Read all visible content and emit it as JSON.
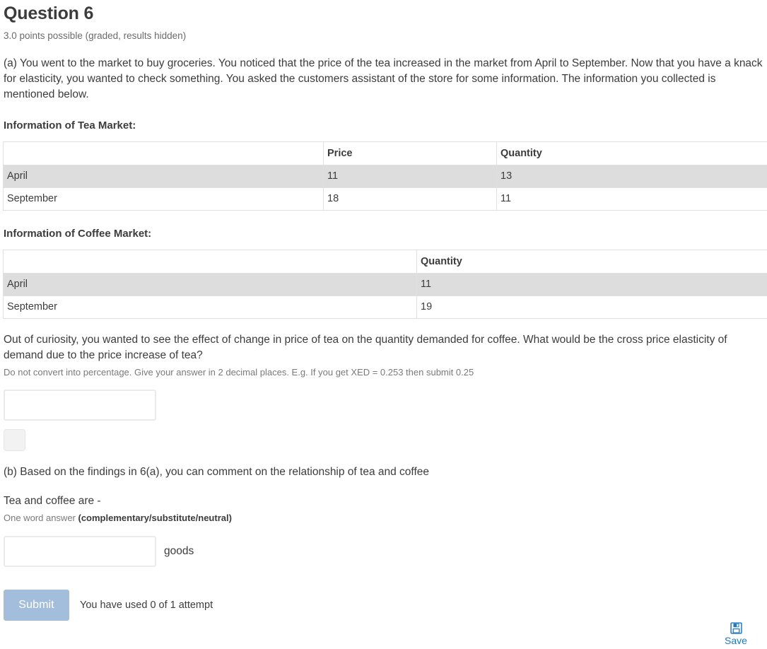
{
  "header": {
    "title": "Question 6",
    "points": "3.0 points possible (graded, results hidden)"
  },
  "part_a": {
    "prompt": "(a) You went to the market to buy groceries. You noticed that the price of the tea increased in the market from April to September. Now that you have a knack for elasticity, you wanted to check something. You asked the customers assistant of the store for some information. The information you collected is mentioned below.",
    "tea_table_heading": "Information of Tea Market:",
    "coffee_table_heading": "Information of Coffee Market:",
    "question": "Out of curiosity, you wanted to see the effect of change in price of tea on the quantity demanded for coffee. What would be the cross price elasticity of demand due to the price increase of tea?",
    "hint": "Do not convert into percentage. Give your answer in 2 decimal places. E.g. If you get XED = 0.253 then submit 0.25",
    "answer_value": "",
    "answer_placeholder": "",
    "extra_button_label": ""
  },
  "tea_table": {
    "headers": [
      "",
      "Price",
      "Quantity"
    ],
    "rows": [
      {
        "label": "April",
        "price": "11",
        "quantity": "13"
      },
      {
        "label": "September",
        "price": "18",
        "quantity": "11"
      }
    ]
  },
  "coffee_table": {
    "headers": [
      "",
      "Quantity"
    ],
    "rows": [
      {
        "label": "April",
        "quantity": "11"
      },
      {
        "label": "September",
        "quantity": "19"
      }
    ]
  },
  "part_b": {
    "prompt": "(b) Based on the findings in 6(a), you can comment on the relationship of tea and coffee",
    "question": "Tea and coffee are -",
    "hint_prefix": "One word answer ",
    "hint_bold": "(complementary/substitute/neutral)",
    "answer_value": "",
    "answer_placeholder": "",
    "suffix": "goods"
  },
  "footer": {
    "submit_label": "Submit",
    "attempt_text": "You have used 0 of 1 attempt",
    "save_label": "Save"
  },
  "colors": {
    "submit_bg": "#a3bddd",
    "save_blue": "#1e78c8",
    "row_stripe": "#dddddd",
    "text": "#3c3c3c",
    "muted": "#6b6b6b"
  }
}
